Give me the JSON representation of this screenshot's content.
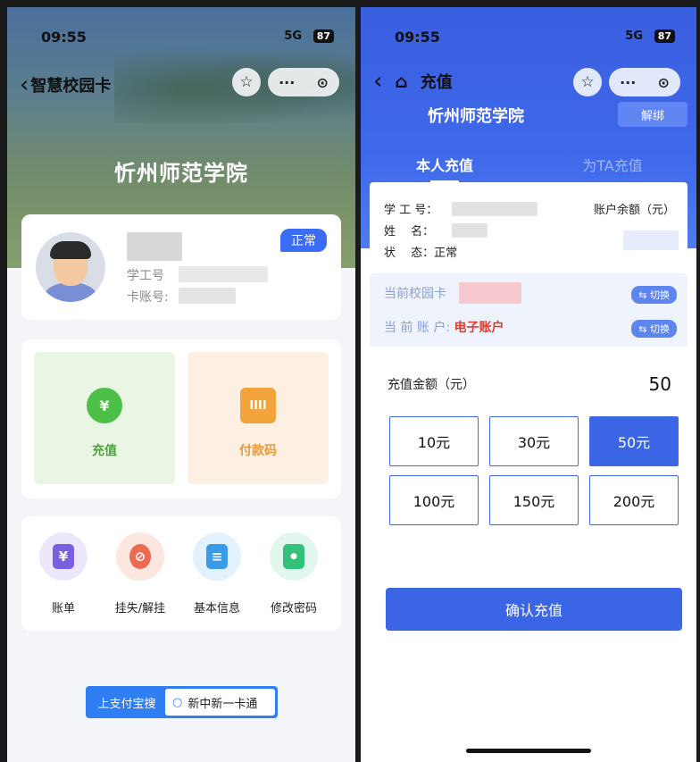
{
  "left": {
    "status": {
      "time": "09:55",
      "signal": "5G",
      "battery": "87"
    },
    "nav": {
      "back_glyph": "‹",
      "title": "智慧校园卡",
      "star_glyph": "☆",
      "more_glyph": "···",
      "target_glyph": "⊙"
    },
    "school_name": "忻州师范学院",
    "user": {
      "student_id_label": "学工号",
      "card_label": "卡账号:",
      "status_badge": "正常"
    },
    "actions": [
      {
        "label": "充值",
        "icon": "yen-bubble-icon",
        "glyph": "¥"
      },
      {
        "label": "付款码",
        "icon": "barcode-icon",
        "glyph": "IIII"
      }
    ],
    "menu": [
      {
        "label": "账单",
        "icon": "bill-icon",
        "glyph": "¥",
        "bg": "#ece8fb",
        "fg": "#7a5fe0"
      },
      {
        "label": "挂失/解挂",
        "icon": "link-icon",
        "glyph": "⊘",
        "bg": "#fde5e0",
        "fg": "#ec6a4f"
      },
      {
        "label": "基本信息",
        "icon": "info-doc-icon",
        "glyph": "≡",
        "bg": "#e2f1fc",
        "fg": "#3b9be6"
      },
      {
        "label": "修改密码",
        "icon": "lock-icon",
        "glyph": "●",
        "bg": "#e1f6ec",
        "fg": "#34c27a"
      }
    ],
    "alipay": {
      "prefix": "上支付宝搜",
      "search_icon": "search-icon",
      "search_glyph": "○",
      "keyword": "新中新一卡通"
    }
  },
  "right": {
    "status": {
      "time": "09:55",
      "signal": "5G",
      "battery": "87"
    },
    "nav": {
      "back_glyph": "‹",
      "home_glyph": "⌂",
      "title": "充值",
      "star_glyph": "☆",
      "more_glyph": "···",
      "target_glyph": "⊙"
    },
    "school_name": "忻州师范学院",
    "unbind_label": "解绑",
    "tabs": [
      {
        "label": "本人充值",
        "active": true
      },
      {
        "label": "为TA充值",
        "active": false
      }
    ],
    "info": {
      "student_id_label": "学 工 号：",
      "name_label": "姓　 名：",
      "status_label": "状　 态：正常",
      "balance_label": "账户余额（元）"
    },
    "current_card_label": "当前校园卡",
    "current_account_label": "当 前 账 户:",
    "current_account_value": "电子账户",
    "switch_label": "切换",
    "switch_glyph": "⇆",
    "amount": {
      "label": "充值金额（元）",
      "value": "50"
    },
    "options": [
      {
        "label": "10元",
        "selected": false
      },
      {
        "label": "30元",
        "selected": false
      },
      {
        "label": "50元",
        "selected": true
      },
      {
        "label": "100元",
        "selected": false
      },
      {
        "label": "150元",
        "selected": false
      },
      {
        "label": "200元",
        "selected": false
      }
    ],
    "confirm_label": "确认充值"
  }
}
